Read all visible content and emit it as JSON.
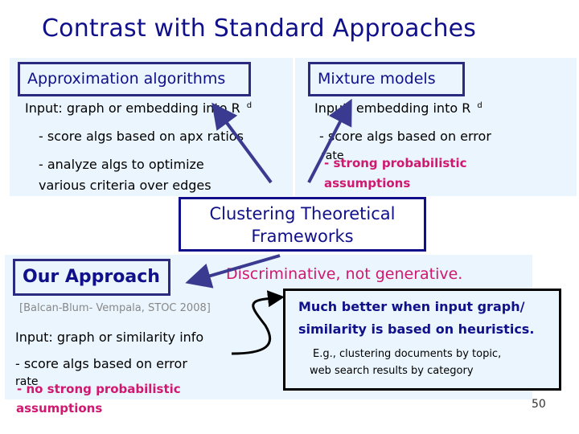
{
  "slide": {
    "title": "Contrast with Standard Approaches",
    "page_number": "50"
  },
  "approx": {
    "heading": "Approximation algorithms",
    "input": "Input: graph or embedding into R",
    "input_sup": "d",
    "bullet1": "-  score  algs based on  apx ratios",
    "bullet2": "- analyze   algs to optimize",
    "bullet2b": "various criteria over edges"
  },
  "mixture": {
    "heading": "Mixture models",
    "input": "Input: embedding into R",
    "input_sup": "d",
    "bullet1": "-  score  algs based on error",
    "bullet1b": "rate",
    "pink1": "- strong probabilistic",
    "pink2": "assumptions"
  },
  "center": {
    "line1": "Clustering Theoretical",
    "line2": "Frameworks"
  },
  "ours": {
    "heading": "Our Approach",
    "citation": "[Balcan-Blum-  Vempala, STOC 2008]",
    "input": "Input: graph or similarity info",
    "bullet1": "-  score  algs based on error",
    "bullet1b": "rate",
    "pink1": "- no strong probabilistic",
    "pink2": "assumptions"
  },
  "discriminative": "Discriminative, not generative.",
  "note": {
    "line1": "Much better when input graph/",
    "line2": "similarity is based on heuristics.",
    "eg1": "E.g., clustering documents by topic,",
    "eg2": "web search results by category"
  },
  "colors": {
    "heading_blue": "#10108a",
    "box_border": "#2a2a80",
    "panel_bg": "#eaf5fd",
    "pink": "#d01870",
    "arrow": "#3a3a90"
  }
}
